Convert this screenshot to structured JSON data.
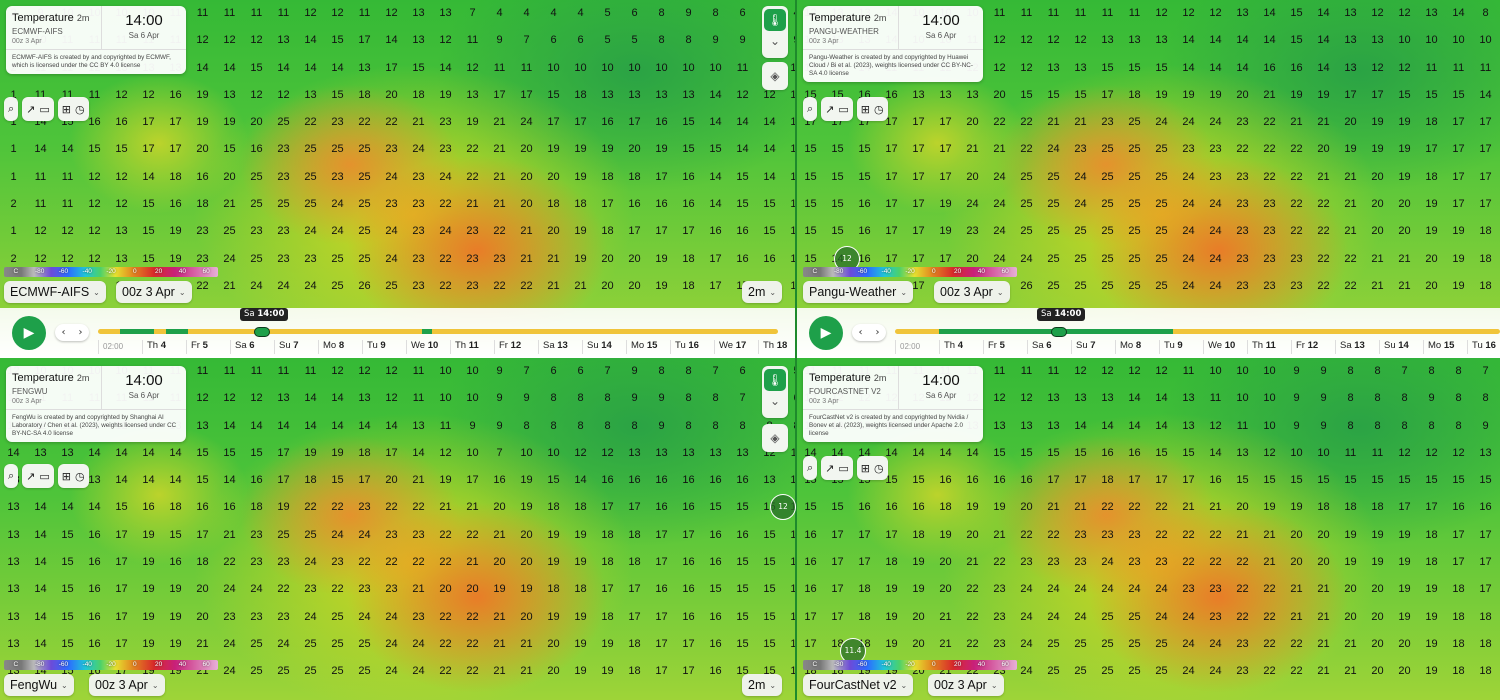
{
  "panels": {
    "tl": {
      "variable": "Temperature",
      "level": "2m",
      "model": "ECMWF-AIFS",
      "run_short": "00z 3 Apr",
      "time": "14:00",
      "date": "Sa 6 Apr",
      "license": "ECMWF-AIFS is created by and copyrighted by ECMWF, which is licensed under the CC BY 4.0 license",
      "model_pill": "ECMWF-AIFS",
      "run_pill": "00z 3 Apr",
      "level_pill": "2m"
    },
    "tr": {
      "variable": "Temperature",
      "level": "2m",
      "model": "PANGU-WEATHER",
      "run_short": "00z 3 Apr",
      "time": "14:00",
      "date": "Sa 6 Apr",
      "license": "Pangu-Weather is created by and copyrighted by Huawei Cloud / Bi et al. (2023), weights licensed under CC BY-NC-SA 4.0 license",
      "model_pill": "Pangu-Weather",
      "run_pill": "00z 3 Apr",
      "marker": "12"
    },
    "bl": {
      "variable": "Temperature",
      "level": "2m",
      "model": "FENGWU",
      "run_short": "00z 3 Apr",
      "time": "14:00",
      "date": "Sa 6 Apr",
      "license": "FengWu is created by and copyrighted by Shanghai AI Laboratory / Chen et al. (2023), weights licensed under CC BY-NC-SA 4.0 license",
      "model_pill": "FengWu",
      "run_pill": "00z 3 Apr",
      "level_pill": "2m",
      "marker": "12"
    },
    "br": {
      "variable": "Temperature",
      "level": "2m",
      "model": "FOURCASTNET V2",
      "run_short": "00z 3 Apr",
      "time": "14:00",
      "date": "Sa 6 Apr",
      "license": "FourCastNet v2 is created by and copyrighted by Nvidia / Bonev et al. (2023), weights licensed under Apache 2.0 license",
      "model_pill": "FourCastNet v2",
      "run_pill": "00z 3 Apr",
      "marker": "11.4"
    }
  },
  "legend": {
    "unit": "C",
    "ticks": [
      "-80",
      "-60",
      "-40",
      "-20",
      "0",
      "20",
      "40",
      "60"
    ]
  },
  "timeline": {
    "cursor_label_day": "Sa",
    "cursor_label_time": "14:00",
    "days": [
      [
        "02:00",
        ""
      ],
      [
        "Th",
        "4"
      ],
      [
        "Fr",
        "5"
      ],
      [
        "Sa",
        "6"
      ],
      [
        "Su",
        "7"
      ],
      [
        "Mo",
        "8"
      ],
      [
        "Tu",
        "9"
      ],
      [
        "We",
        "10"
      ],
      [
        "Th",
        "11"
      ],
      [
        "Fr",
        "12"
      ],
      [
        "Sa",
        "13"
      ],
      [
        "Su",
        "14"
      ],
      [
        "Mo",
        "15"
      ],
      [
        "Tu",
        "16"
      ],
      [
        "We",
        "17"
      ],
      [
        "Th",
        "18"
      ]
    ]
  },
  "grids": {
    "tl": [
      "2 9 10 10 10 10 11 11 11 11 11 12 12 11 12 13 13 7 4 4 4 4 5 6 8 9 8 6 5 4",
      "2 10 11 11 11 11 11 12 12 12 13 14 15 17 14 13 12 11 9 7 6 6 5 5 8 8 9 9 9 9",
      "2 11 11 12 13 13 13 14 14 15 14 14 14 13 17 15 14 12 11 11 10 10 10 10 10 10 10 11 10 10",
      "1 11 11 11 12 12 16 19 13 12 12 13 15 18 20 18 19 13 17 17 15 18 13 13 13 13 14 12 12 13",
      "1 14 15 16 16 17 17 19 19 20 25 22 23 22 22 21 23 19 21 24 17 17 16 17 16 15 14 14 14 13",
      "1 14 14 15 15 17 17 20 15 16 23 25 25 25 23 24 23 22 21 20 19 19 19 20 19 15 15 14 14 14",
      "1 11 11 12 12 14 18 16 20 25 23 25 23 25 24 23 24 22 21 20 20 19 18 18 17 16 14 15 14 14",
      "2 11 11 12 12 15 16 18 21 25 25 25 24 25 23 23 22 21 21 20 18 18 17 16 16 16 14 15 15 14",
      "1 12 12 12 13 15 19 23 25 23 23 24 24 25 24 23 24 23 22 21 20 19 18 17 17 17 16 16 15 15",
      "2 12 12 12 13 15 19 23 24 25 23 23 25 25 24 23 22 23 23 21 21 19 20 20 19 18 17 16 16 15",
      "1 11 12 13 13 15 20 22 21 24 24 24 25 26 25 23 22 23 22 22 21 21 20 20 19 18 17 17 16 16"
    ],
    "tr": [
      "12 13 13 14 10 10 10 11 11 11 11 11 11 12 12 12 13 14 15 14 13 12 12 13 14 8 7 6 5 5",
      "12 13 13 14 10 10 11 12 12 12 12 13 13 13 14 14 14 14 15 14 13 13 10 10 10 10 10 9 9 9",
      "13 13 14 11 11 12 12 12 12 13 13 15 15 15 14 14 14 16 16 14 13 12 12 11 11 11 10 10 10 10",
      "15 15 16 16 13 13 13 20 15 15 15 17 18 19 19 19 20 21 19 19 17 17 15 15 15 14 14 14 14 14",
      "17 17 17 17 17 17 20 22 22 21 21 23 25 24 24 24 23 22 21 21 20 19 19 18 17 17 15 16 15 15",
      "15 15 15 17 17 17 21 21 22 24 23 25 25 25 23 23 22 22 22 20 19 19 19 17 17 17 15 15 14 14",
      "15 15 15 17 17 17 20 24 25 25 24 25 25 25 24 23 23 22 22 21 21 20 19 18 17 17 16 16 14 14",
      "15 15 16 17 17 19 24 24 25 25 24 25 25 25 24 24 23 23 22 22 21 20 20 19 17 17 16 15 15 14",
      "15 15 16 17 17 19 23 24 25 25 25 25 25 25 24 24 23 23 22 22 21 20 20 19 19 18 17 16 16 15",
      "15 14 16 17 17 17 20 24 24 25 25 25 25 25 24 24 23 23 23 22 22 21 21 20 19 18 17 17 16 16",
      "15 14 15 17 17 17 20 25 26 25 25 25 25 25 24 24 23 23 23 22 22 21 21 20 19 18 17 17 16 16"
    ],
    "bl": [
      "12 10 10 10 10 11 11 11 11 11 11 11 12 12 12 11 10 10 9 7 6 6 7 9 8 8 7 6 6 5",
      "11 11 11 11 11 11 11 12 12 12 13 14 14 13 12 11 10 10 9 9 8 8 8 9 9 8 8 7 7 6",
      "13 12 12 12 12 13 13 13 14 14 14 14 14 14 14 13 11 9 9 8 8 8 8 8 9 8 8 8 8 8",
      "14 13 13 14 14 14 14 15 15 15 17 19 19 18 17 14 12 10 7 10 10 12 12 13 13 13 13 13 12 11",
      "13 13 13 13 14 14 14 15 14 16 17 18 15 17 20 21 19 17 16 19 15 14 16 16 16 16 16 16 13 12",
      "13 14 14 14 15 16 18 16 16 18 19 22 22 23 22 22 21 21 20 19 18 18 17 17 16 16 15 15 15 12",
      "13 14 15 16 17 19 15 17 21 23 25 25 24 24 23 23 22 22 21 20 19 19 18 18 17 17 16 16 15 15",
      "13 14 15 16 17 19 16 18 22 23 23 24 23 22 22 22 22 21 20 20 19 19 18 18 17 16 16 15 15 14",
      "13 14 15 16 17 19 19 20 24 24 22 23 22 23 23 21 20 20 19 19 18 18 17 17 16 16 15 15 15 14",
      "13 14 15 16 17 19 19 20 23 23 23 24 25 24 24 23 22 22 21 20 19 19 18 17 17 16 16 15 15 14",
      "13 14 15 16 17 19 19 21 24 25 24 25 25 25 24 24 22 22 21 21 20 19 19 18 17 17 16 15 15 14",
      "13 14 15 16 17 19 19 21 24 25 25 25 25 25 24 24 22 22 21 21 20 19 19 18 17 17 16 15 15 14"
    ],
    "br": [
      "11 11 11 11 11 11 11 11 11 11 12 12 12 12 11 10 10 10 9 9 8 8 7 8 8 7 8 7 7 6",
      "12 12 12 12 12 12 12 12 12 13 13 13 14 14 13 11 10 10 9 9 8 8 8 9 8 8 8 7 7 7",
      "13 13 13 12 12 13 13 13 13 13 14 14 14 14 13 12 11 10 9 9 8 8 8 8 8 9 8 8 8 8",
      "14 14 14 14 14 14 14 15 15 15 15 16 16 15 15 14 13 12 10 10 11 11 12 12 12 13 13 12 12 12",
      "15 15 15 15 15 16 16 16 16 17 17 18 17 17 17 16 15 15 15 15 15 15 15 15 15 15 15 14 13 13",
      "15 15 16 16 16 18 19 19 20 21 21 22 22 22 21 21 20 19 19 18 18 18 17 17 16 16 16 15 15 14",
      "16 17 17 17 18 19 20 21 22 22 23 23 23 22 22 22 21 21 20 20 19 19 19 18 17 17 16 16 15 15",
      "16 17 17 18 19 20 21 22 23 23 23 24 23 23 22 22 22 21 20 20 19 19 19 18 17 17 16 16 15 15",
      "16 17 18 19 19 20 22 23 24 24 24 24 24 24 23 23 22 22 21 21 20 20 19 19 18 17 17 16 16 15",
      "17 17 18 19 20 21 22 23 24 24 24 25 25 24 24 23 22 22 21 21 20 20 19 19 18 18 17 16 16 15",
      "17 18 18 19 20 21 22 23 24 25 25 25 25 25 24 24 23 22 22 21 21 20 20 19 18 18 17 17 16 16",
      "18 18 19 19 20 21 22 23 24 25 25 25 25 25 24 24 23 22 22 21 21 20 20 19 18 18 17 17 16 16"
    ]
  },
  "ui": {
    "search": "⌕",
    "share": "↗",
    "camera": "▭",
    "grid": "⊞",
    "clock": "◷",
    "chev": "⌄",
    "layers": "◈",
    "thermo": "🌡",
    "prev": "‹",
    "next": "›",
    "play": "▶"
  }
}
